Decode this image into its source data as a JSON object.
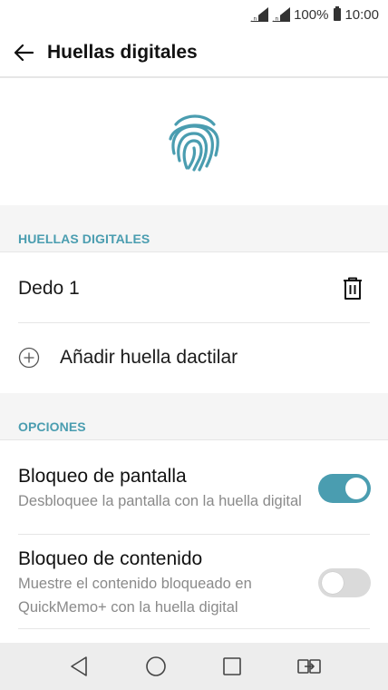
{
  "status_bar": {
    "battery": "100%",
    "time": "10:00",
    "icons": [
      "signal-icon",
      "signal-icon",
      "battery-icon"
    ]
  },
  "app_bar": {
    "title": "Huellas digitales",
    "back_icon": "arrow-left-icon"
  },
  "hero": {
    "icon": "fingerprint-icon",
    "color": "#4a9db0"
  },
  "fingerprints_section": {
    "header": "HUELLAS DIGITALES",
    "items": [
      {
        "label": "Dedo 1",
        "action_icon": "trash-icon"
      }
    ],
    "add_label": "Añadir huella dactilar",
    "add_icon": "plus-circle-icon"
  },
  "options_section": {
    "header": "OPCIONES",
    "items": [
      {
        "title": "Bloqueo de pantalla",
        "subtitle": "Desbloquee la pantalla con la huella digital",
        "enabled": true
      },
      {
        "title": "Bloqueo de contenido",
        "subtitle": "Muestre el contenido bloqueado en QuickMemo+ con la huella digital",
        "enabled": false
      }
    ]
  },
  "nav_bar": {
    "icons": [
      "back-triangle-icon",
      "home-circle-icon",
      "recents-square-icon",
      "dual-window-icon"
    ]
  },
  "colors": {
    "accent": "#4a9db0",
    "section_bg": "#f5f5f5",
    "nav_bg": "#ededed",
    "toggle_off": "#dadada"
  }
}
